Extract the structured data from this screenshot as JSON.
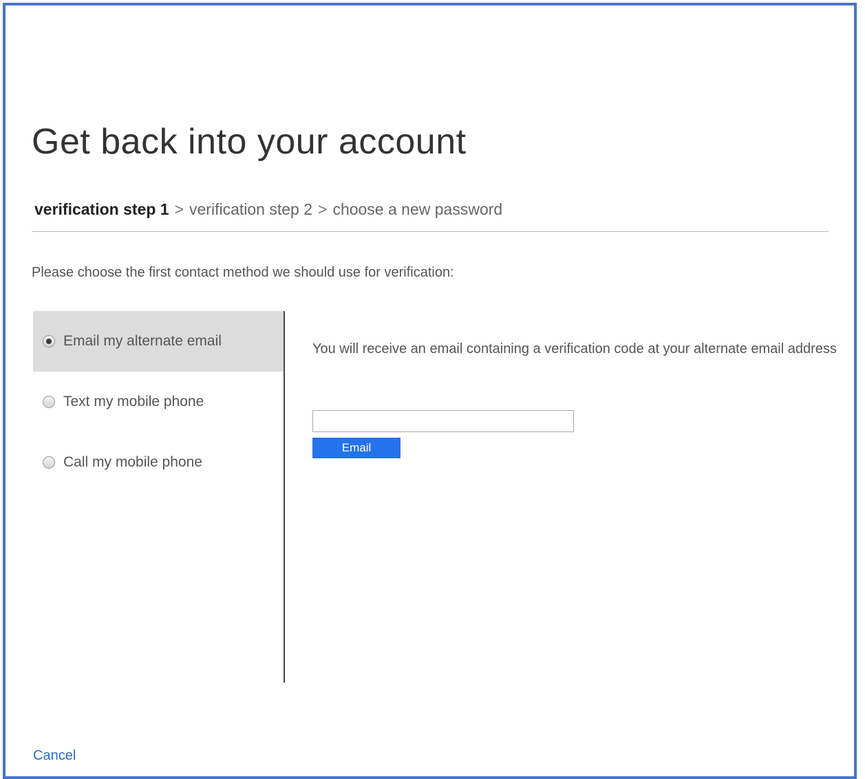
{
  "page": {
    "title": "Get back into your account"
  },
  "steps": {
    "current": "verification step 1",
    "separator_1": ">",
    "next": "verification step 2",
    "separator_2": ">",
    "last": "choose a new password"
  },
  "instructions": "Please choose the first contact method we should use for verification:",
  "methods": [
    {
      "label": "Email my alternate email",
      "selected": true
    },
    {
      "label": "Text my mobile phone",
      "selected": false
    },
    {
      "label": "Call my mobile phone",
      "selected": false
    }
  ],
  "detail": {
    "text": "You will receive an email containing a verification code at your alternate email address"
  },
  "email_input": {
    "placeholder": "",
    "value": ""
  },
  "email_button": {
    "label": "Email"
  },
  "cancel_label": "Cancel",
  "colors": {
    "frame_border": "#4a74c9",
    "link": "#2a6fc9",
    "selected_method_bg": "#dcdcdc",
    "primary_button": "#2672ec"
  }
}
